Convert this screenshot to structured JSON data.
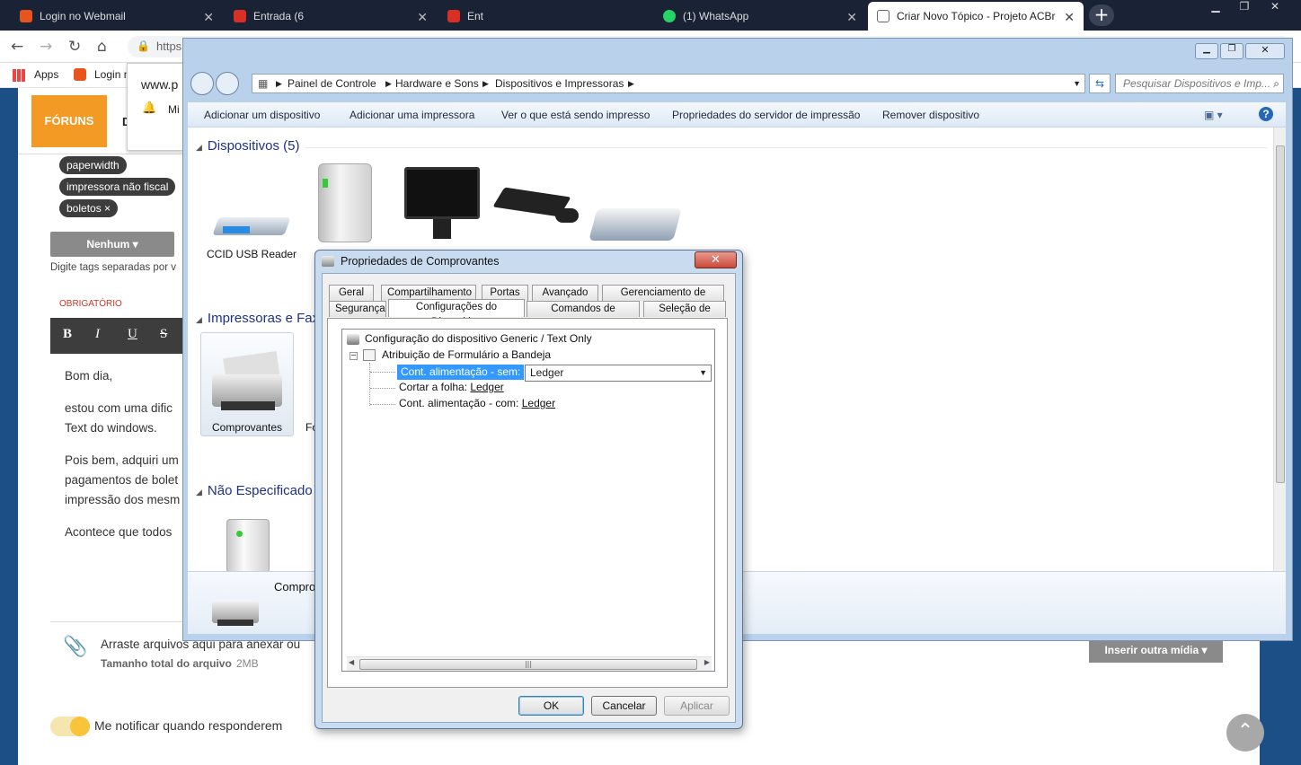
{
  "browser": {
    "tabs": [
      {
        "label": "Login no Webmail",
        "favicon_color": "#e8551c"
      },
      {
        "label": "Entrada (6",
        "favicon_color": "#d93025"
      },
      {
        "label": "Ent",
        "favicon_color": "#d93025"
      },
      {
        "label": "(1) WhatsApp",
        "favicon_color": "#25d366"
      },
      {
        "label": "Criar Novo Tópico - Projeto ACBr",
        "favicon_color": "#666666"
      }
    ],
    "address": "https://",
    "bookmarks": {
      "apps": "Apps",
      "login": "Login n"
    }
  },
  "website": {
    "url_fragment": "www.p",
    "nav_button": "FÓRUNS",
    "nav_letter": "D",
    "notif_letter": "Mi",
    "tags": [
      "paperwidth",
      "impressora não fiscal",
      "boletos ×"
    ],
    "dropdown": "Nenhum ▾",
    "hint": "Digite tags separadas por v",
    "required": "OBRIGATÓRIO",
    "editor_buttons": [
      "B",
      "I",
      "U",
      "S"
    ],
    "body": [
      "Bom dia,",
      "estou com uma dific",
      "Text do windows.",
      "Pois bem, adquiri um",
      "pagamentos de bolet",
      "impressão dos mesm",
      "Acontece que todos"
    ],
    "attach_text": "Arraste arquivos aqui para anexar ou ",
    "attach_size_label": "Tamanho total do arquivo",
    "attach_size_value": "2MB",
    "insert_media": "Inserir outra mídia ▾",
    "notify": "Me notificar quando responderem",
    "scroll_top": "⌃"
  },
  "explorer": {
    "breadcrumb": [
      "Painel de Controle",
      "Hardware e Sons",
      "Dispositivos e Impressoras"
    ],
    "search_placeholder": "Pesquisar Dispositivos e Imp...",
    "commands": [
      "Adicionar um dispositivo",
      "Adicionar uma impressora",
      "Ver o que está sendo impresso",
      "Propriedades do servidor de impressão",
      "Remover dispositivo"
    ],
    "groups": {
      "devices": "Dispositivos (5)",
      "printers": "Impressoras e Faxe",
      "unspecified": "Não Especificado"
    },
    "device_labels": {
      "ccid": "CCID USB Reader",
      "comprovantes": "Comprovantes",
      "fo": "Fo",
      "details_name": "Compro"
    }
  },
  "dialog": {
    "title": "Propriedades de Comprovantes",
    "close": "✕",
    "tabs_row1": [
      "Geral",
      "Compartilhamento",
      "Portas",
      "Avançado",
      "Gerenciamento de Cores"
    ],
    "tabs_row2": [
      "Segurança",
      "Configurações do Dispositivo",
      "Comandos de impressora",
      "Seleção de fonte"
    ],
    "tree": {
      "root": "Configuração do dispositivo Generic / Text Only",
      "child": "Atribuição de Formulário a Bandeja",
      "leaf1_label": "Cont. alimentação - sem:",
      "leaf1_value": "Ledger",
      "leaf2_label": "Cortar a folha: ",
      "leaf2_value": "Ledger",
      "leaf3_label": "Cont. alimentação - com: ",
      "leaf3_value": "Ledger"
    },
    "buttons": {
      "ok": "OK",
      "cancel": "Cancelar",
      "apply": "Aplicar"
    }
  }
}
